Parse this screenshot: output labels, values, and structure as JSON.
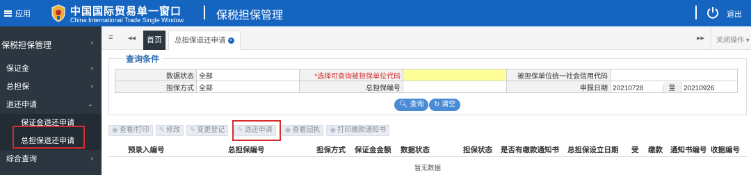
{
  "header": {
    "menu_label": "应用",
    "brand_cn": "中国国际贸易单一窗口",
    "brand_en": "China International Trade Single Window",
    "section_title": "保税担保管理",
    "logout_label": "退出",
    "bg_color": "#1565c0"
  },
  "sidebar": {
    "title": "保税担保管理",
    "items": [
      {
        "label": "保证金"
      },
      {
        "label": "总担保"
      },
      {
        "label": "退还申请"
      }
    ],
    "sub_items": [
      {
        "label": "保证金退还申请"
      },
      {
        "label": "总担保退还申请"
      }
    ],
    "bottom_item": "综合查询"
  },
  "tabs": {
    "home": "首页",
    "active": "总担保退还申请",
    "close_ops": "关闭操作"
  },
  "query": {
    "title": "查询条件",
    "row1": {
      "status_label": "数据状态",
      "status_value": "全部",
      "unit_code_label": "*选择可查询被担保单位代码",
      "unit_code_value": "",
      "credit_code_label": "被担保单位统一社会信用代码",
      "credit_code_value": ""
    },
    "row2": {
      "method_label": "担保方式",
      "method_value": "全部",
      "guarantee_no_label": "总担保编号",
      "guarantee_no_value": "",
      "date_label": "申报日期",
      "date_from": "20210728",
      "date_to_label": "至",
      "date_to": "20210926"
    },
    "search_btn": "查询",
    "clear_btn": "清空"
  },
  "toolbar": {
    "view_print": "查看/打印",
    "edit": "修改",
    "change_reg": "变更登记",
    "refund_apply": "退还申请",
    "view_receipt": "查看回执",
    "print_notice": "打印缴款通知书"
  },
  "results": {
    "columns": [
      "预录入编号",
      "总担保编号",
      "担保方式",
      "保证金金额",
      "数据状态",
      "担保状态",
      "是否有缴款通知书",
      "总担保设立日期",
      "受",
      "缴款",
      "通知书编号",
      "收据编号"
    ],
    "empty_text": "暂无数据"
  }
}
